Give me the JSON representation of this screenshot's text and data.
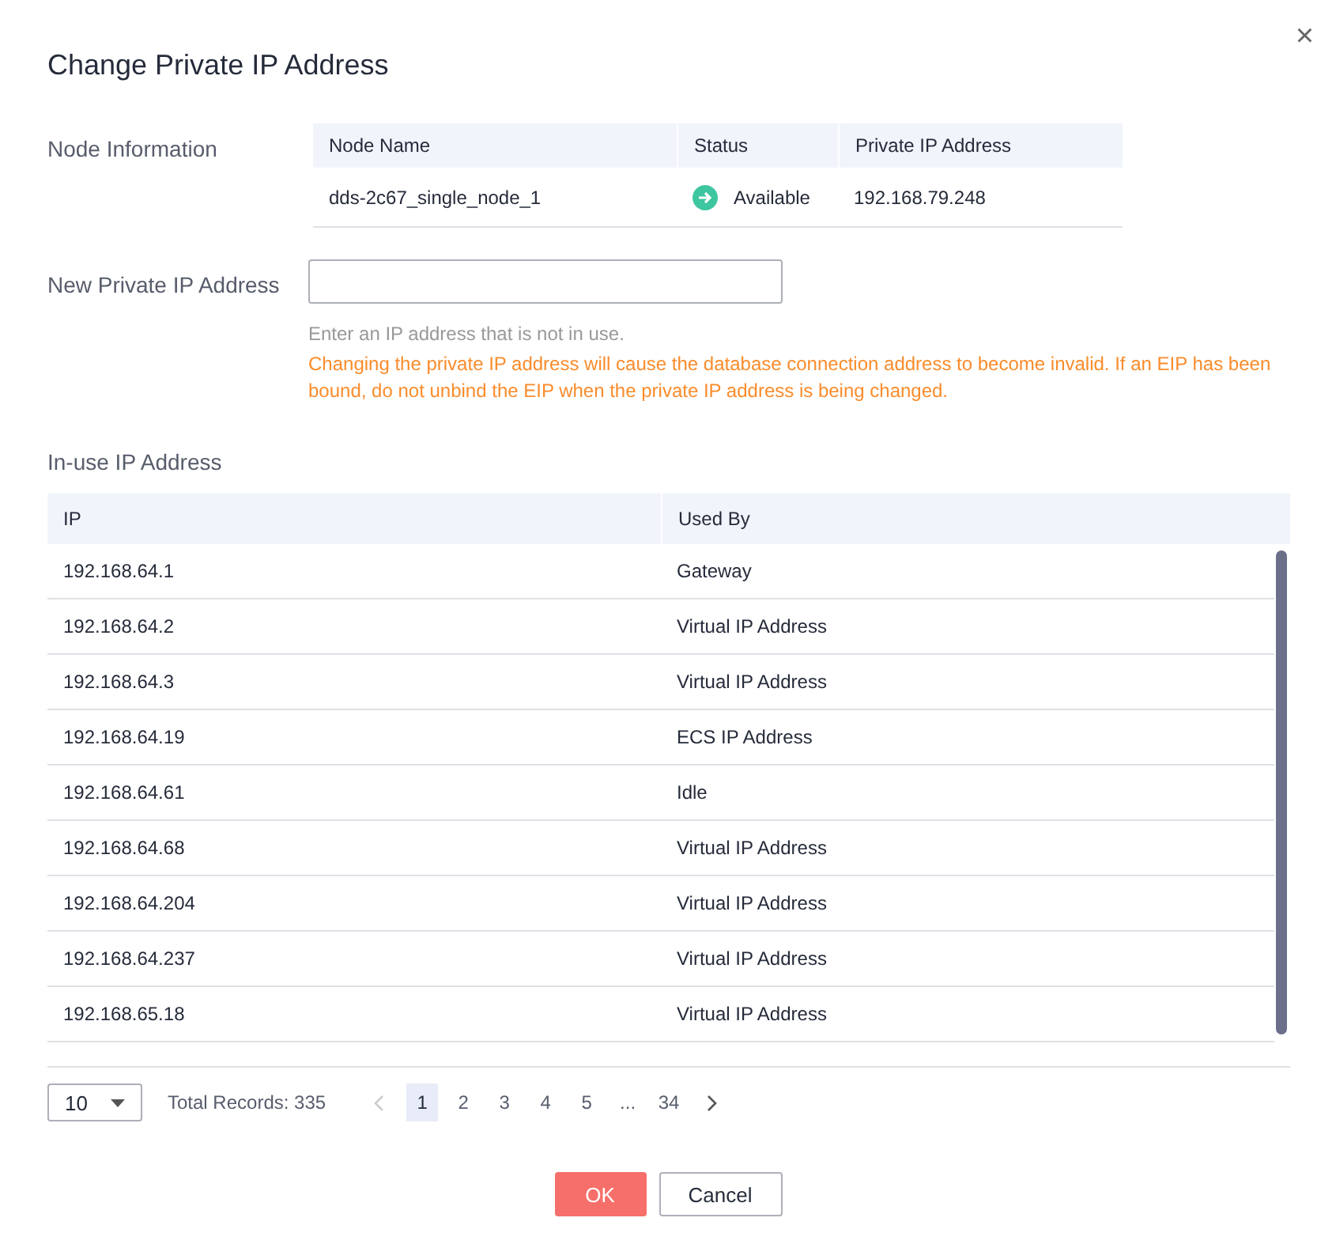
{
  "dialog": {
    "title": "Change Private IP Address",
    "close": "×"
  },
  "node_info": {
    "label": "Node Information",
    "columns": [
      "Node Name",
      "Status",
      "Private IP Address"
    ],
    "rows": [
      {
        "name": "dds-2c67_single_node_1",
        "status": "Available",
        "ip": "192.168.79.248"
      }
    ]
  },
  "new_ip": {
    "label": "New Private IP Address",
    "hint": "Enter an IP address that is not in use.",
    "warning": "Changing the private IP address will cause the database connection address to become invalid. If an EIP has been bound, do not unbind the EIP when the private IP address is being changed."
  },
  "in_use": {
    "label": "In-use IP Address",
    "columns": [
      "IP",
      "Used By"
    ],
    "rows": [
      [
        "192.168.64.1",
        "Gateway"
      ],
      [
        "192.168.64.2",
        "Virtual IP Address"
      ],
      [
        "192.168.64.3",
        "Virtual IP Address"
      ],
      [
        "192.168.64.19",
        "ECS IP Address"
      ],
      [
        "192.168.64.61",
        "Idle"
      ],
      [
        "192.168.64.68",
        "Virtual IP Address"
      ],
      [
        "192.168.64.204",
        "Virtual IP Address"
      ],
      [
        "192.168.64.237",
        "Virtual IP Address"
      ],
      [
        "192.168.65.18",
        "Virtual IP Address"
      ]
    ]
  },
  "pagination": {
    "page_size": "10",
    "total": "Total Records: 335",
    "prev_disabled": true,
    "pages": [
      {
        "label": "1",
        "selected": true
      },
      {
        "label": "2",
        "selected": false
      },
      {
        "label": "3",
        "selected": false
      },
      {
        "label": "4",
        "selected": false
      },
      {
        "label": "5",
        "selected": false
      },
      {
        "label": "...",
        "selected": false
      },
      {
        "label": "34",
        "selected": false
      }
    ]
  },
  "buttons": [
    {
      "label": "OK",
      "kind": "primary"
    },
    {
      "label": "Cancel",
      "kind": "secondary"
    }
  ]
}
